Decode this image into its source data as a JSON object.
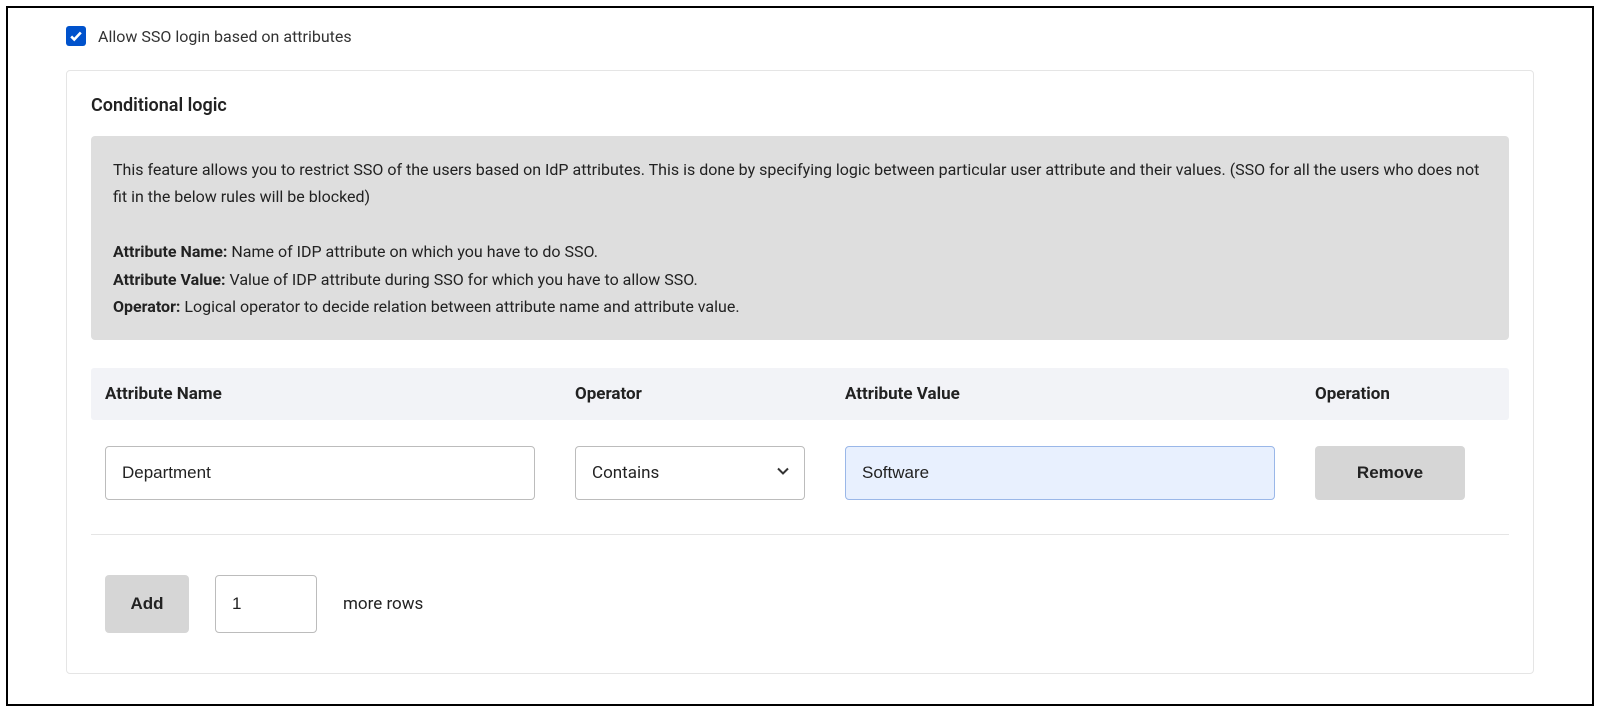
{
  "checkbox": {
    "checked": true,
    "label": "Allow SSO login based on attributes"
  },
  "panel": {
    "title": "Conditional logic",
    "description": "This feature allows you to restrict SSO of the users based on IdP attributes. This is done by specifying logic between particular user attribute and their values. (SSO for all the users who does not fit in the below rules will be blocked)",
    "definitions": {
      "attr_name_label": "Attribute Name:",
      "attr_name_text": " Name of IDP attribute on which you have to do SSO.",
      "attr_value_label": "Attribute Value:",
      "attr_value_text": " Value of IDP attribute during SSO for which you have to allow SSO.",
      "operator_label": "Operator:",
      "operator_text": " Logical operator to decide relation between attribute name and attribute value."
    }
  },
  "table": {
    "headers": {
      "attr_name": "Attribute Name",
      "operator": "Operator",
      "attr_value": "Attribute Value",
      "operation": "Operation"
    },
    "rows": [
      {
        "attr_name": "Department",
        "operator": "Contains",
        "attr_value": "Software",
        "remove_label": "Remove"
      }
    ]
  },
  "add_row": {
    "button_label": "Add",
    "count": "1",
    "suffix": "more rows"
  }
}
